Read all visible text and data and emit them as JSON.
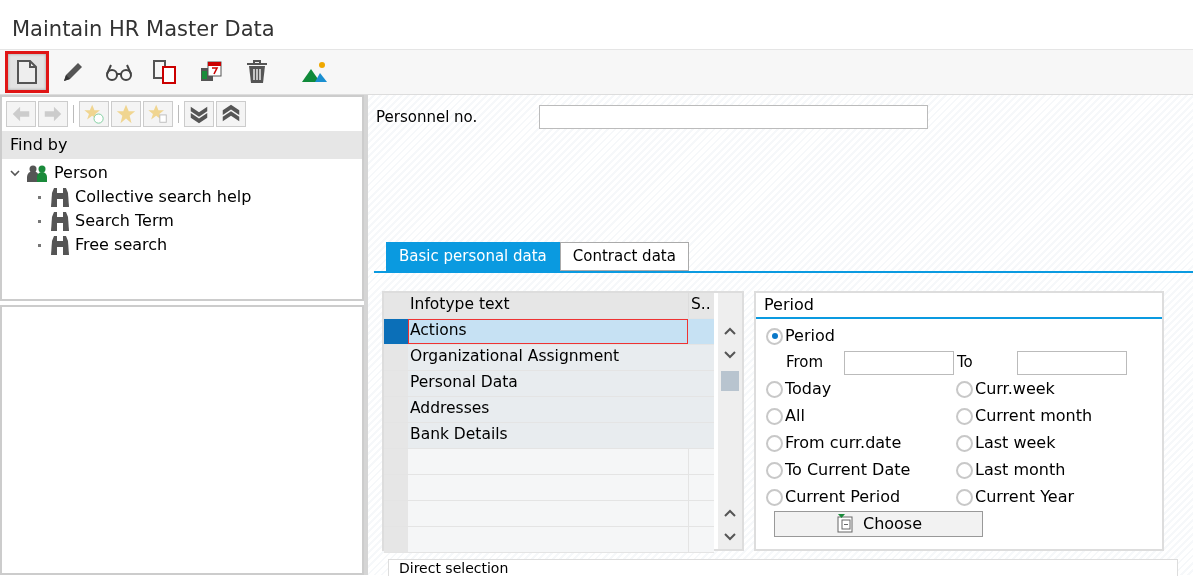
{
  "window": {
    "title": "Maintain HR Master Data"
  },
  "toolbar": [
    {
      "kind": "page",
      "highlighted": true
    },
    {
      "kind": "pencil",
      "highlighted": false
    },
    {
      "kind": "glasses",
      "highlighted": false
    },
    {
      "kind": "copy",
      "highlighted": false
    },
    {
      "kind": "calendar",
      "highlighted": false
    },
    {
      "kind": "trash",
      "highlighted": false
    },
    {
      "kind": "mountain",
      "highlighted": false
    }
  ],
  "find_panel": {
    "header": "Find by",
    "tree": [
      {
        "label": "Person",
        "expanded": true,
        "kind": "people",
        "children": [
          {
            "label": "Collective search help",
            "kind": "search"
          },
          {
            "label": "Search Term",
            "kind": "search"
          },
          {
            "label": "Free search",
            "kind": "search"
          }
        ]
      }
    ]
  },
  "personnel": {
    "label": "Personnel no."
  },
  "tabs": [
    {
      "label": "Basic personal data",
      "selected": true
    },
    {
      "label": "Contract data",
      "selected": false
    }
  ],
  "infotype_table": {
    "columns": [
      "Infotype text",
      "S.."
    ],
    "rows": [
      {
        "text": "Actions",
        "selected": true
      },
      {
        "text": "Organizational Assignment",
        "selected": false
      },
      {
        "text": "Personal Data",
        "selected": false
      },
      {
        "text": "Addresses",
        "selected": false
      },
      {
        "text": "Bank Details",
        "selected": false
      }
    ]
  },
  "period": {
    "title": "Period",
    "main_option": {
      "label": "Period",
      "selected": true
    },
    "from_label": "From",
    "to_label": "To",
    "options": [
      {
        "label": "Today",
        "selected": false
      },
      {
        "label": "Curr.week",
        "selected": false
      },
      {
        "label": "All",
        "selected": false
      },
      {
        "label": "Current month",
        "selected": false
      },
      {
        "label": "From curr.date",
        "selected": false
      },
      {
        "label": "Last week",
        "selected": false
      },
      {
        "label": "To Current Date",
        "selected": false
      },
      {
        "label": "Last month",
        "selected": false
      },
      {
        "label": "Current Period",
        "selected": false
      },
      {
        "label": "Current Year",
        "selected": false
      }
    ],
    "choose_button": "Choose"
  },
  "direct_selection": {
    "title": "Direct selection"
  }
}
